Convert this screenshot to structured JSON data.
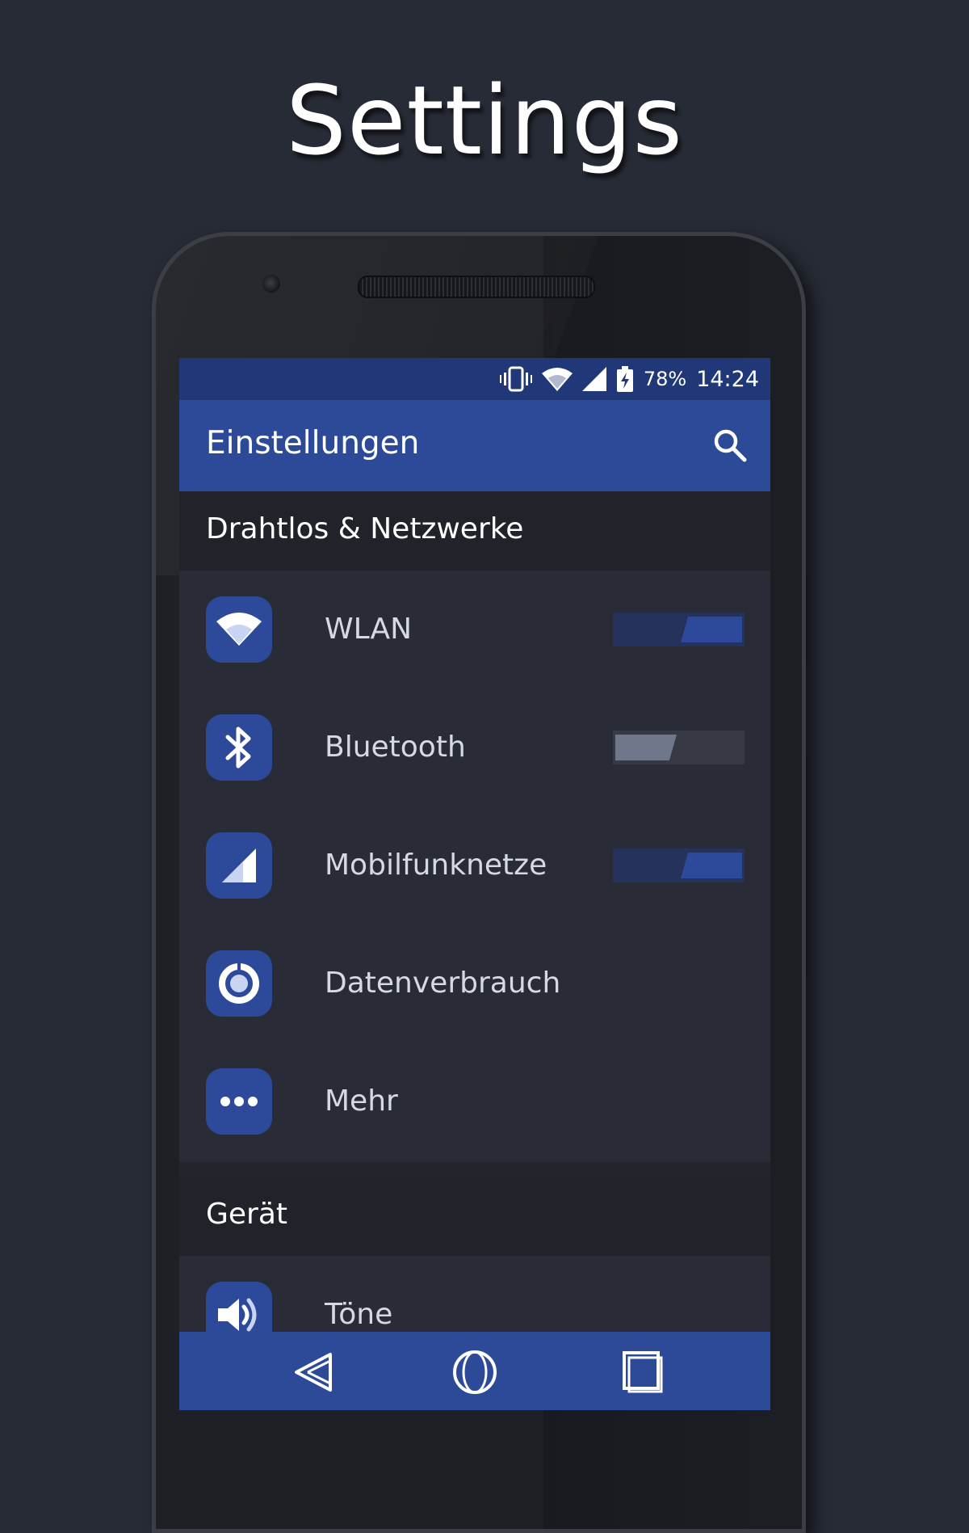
{
  "heading": "Settings",
  "status_bar": {
    "battery": "78%",
    "time": "14:24",
    "icons": [
      "vibrate-icon",
      "wifi-icon",
      "signal-icon",
      "battery-charging-icon"
    ]
  },
  "toolbar": {
    "title": "Einstellungen",
    "search_icon": "search-icon"
  },
  "sections": [
    {
      "title": "Drahtlos & Netzwerke",
      "items": [
        {
          "label": "WLAN",
          "icon": "wifi-icon",
          "toggle": "on"
        },
        {
          "label": "Bluetooth",
          "icon": "bluetooth-icon",
          "toggle": "off"
        },
        {
          "label": "Mobilfunknetze",
          "icon": "signal-icon",
          "toggle": "on"
        },
        {
          "label": "Datenverbrauch",
          "icon": "data-usage-icon"
        },
        {
          "label": "Mehr",
          "icon": "more-icon"
        }
      ]
    },
    {
      "title": "Gerät",
      "items": [
        {
          "label": "Töne",
          "icon": "volume-icon"
        }
      ]
    }
  ],
  "nav_bar": {
    "icons": [
      "back-icon",
      "home-icon",
      "recents-icon"
    ]
  },
  "colors": {
    "background": "#272b35",
    "accent": "#2c4a98",
    "status_bar": "#203778",
    "screen": "#292c36",
    "section_header": "#21232a"
  }
}
